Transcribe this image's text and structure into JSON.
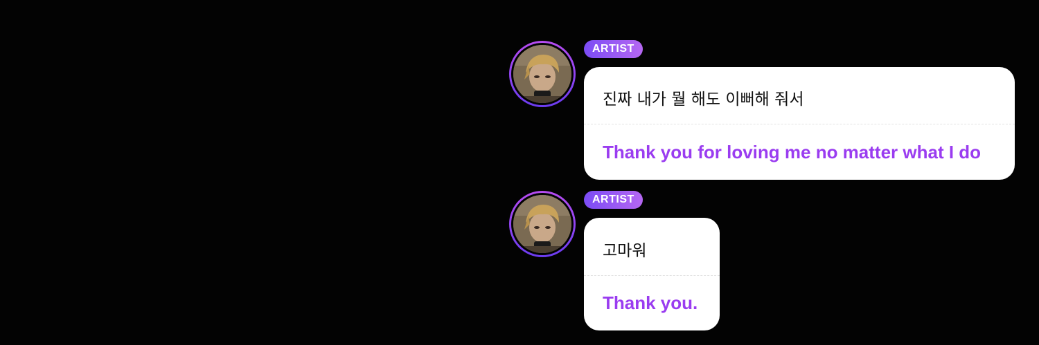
{
  "colors": {
    "background": "#030303",
    "badge_gradient_start": "#7b4cf5",
    "badge_gradient_end": "#b567f2",
    "translation_text": "#9a3cf0",
    "bubble": "#ffffff"
  },
  "messages": [
    {
      "badge": "ARTIST",
      "original": "진짜 내가 뭘 해도 이뻐해 줘서",
      "translation": "Thank you for loving me no matter what I do"
    },
    {
      "badge": "ARTIST",
      "original": "고마워",
      "translation": "Thank you."
    }
  ]
}
